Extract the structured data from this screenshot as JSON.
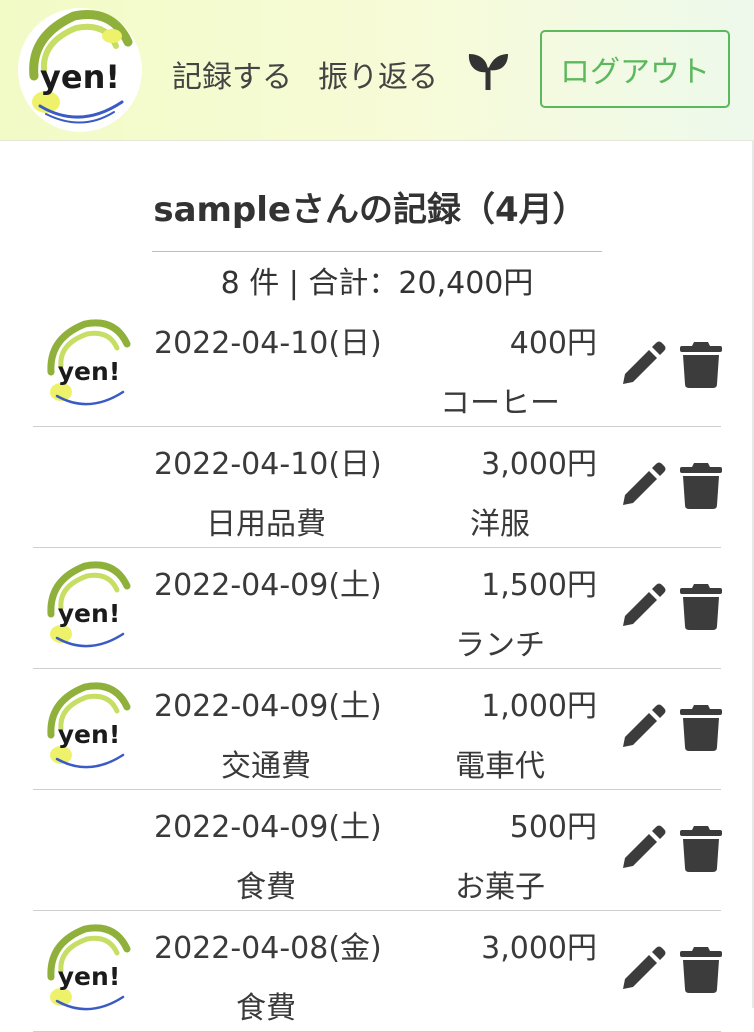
{
  "header": {
    "logo_text": "yen!",
    "nav": {
      "record_label": "記録する",
      "review_label": "振り返る"
    },
    "logout_label": "ログアウト"
  },
  "main": {
    "title": "sampleさんの記録（4月）",
    "summary": "8 件 | 合計：20,400円",
    "records": [
      {
        "date": "2022-04-10(日)",
        "amount": "400円",
        "category": "",
        "memo": "コーヒー",
        "has_image": true
      },
      {
        "date": "2022-04-10(日)",
        "amount": "3,000円",
        "category": "日用品費",
        "memo": "洋服",
        "has_image": false
      },
      {
        "date": "2022-04-09(土)",
        "amount": "1,500円",
        "category": "",
        "memo": "ランチ",
        "has_image": true
      },
      {
        "date": "2022-04-09(土)",
        "amount": "1,000円",
        "category": "交通費",
        "memo": "電車代",
        "has_image": true
      },
      {
        "date": "2022-04-09(土)",
        "amount": "500円",
        "category": "食費",
        "memo": "お菓子",
        "has_image": false
      },
      {
        "date": "2022-04-08(金)",
        "amount": "3,000円",
        "category": "食費",
        "memo": "",
        "has_image": true
      }
    ]
  },
  "icons": {
    "sprout": "sprout-icon",
    "edit": "pencil-icon",
    "delete": "trash-icon"
  },
  "colors": {
    "accent_green": "#5cb85c",
    "icon_dark": "#3c3c3c",
    "header_gradient_start": "#f2fbc6",
    "header_gradient_end": "#eef9ec"
  }
}
